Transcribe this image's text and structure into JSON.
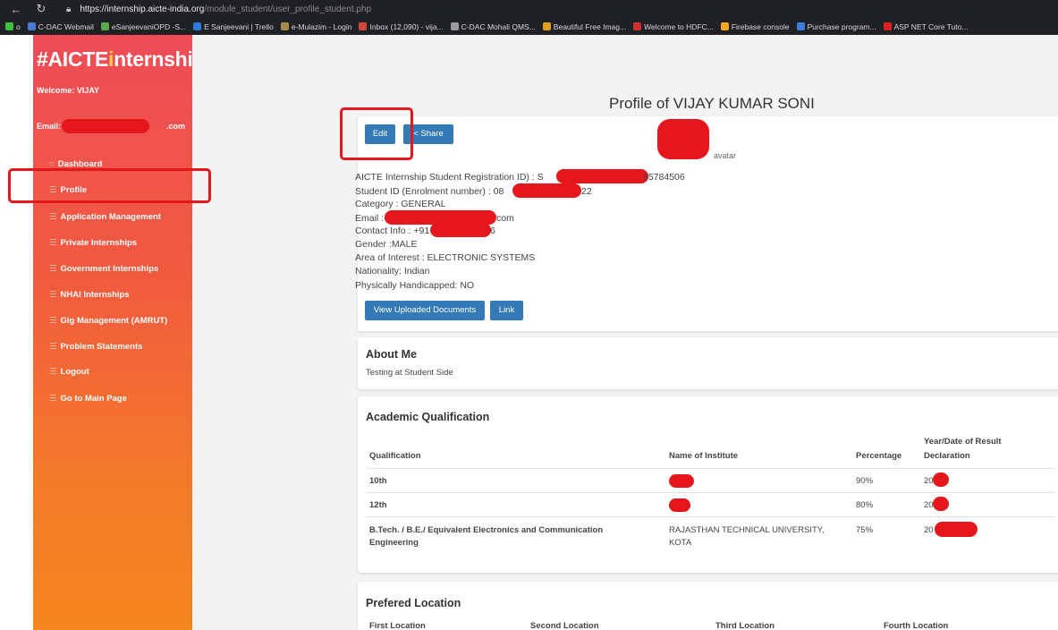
{
  "browser": {
    "url_host": "https://internship.aicte-india.org",
    "url_path": "/module_student/user_profile_student.php",
    "bookmarks": [
      {
        "label": "o",
        "color": "#3fbf3f"
      },
      {
        "label": "C-DAC Webmail",
        "color": "#4a7bd4"
      },
      {
        "label": "eSanjeevaniOPD -S...",
        "color": "#5aa64a"
      },
      {
        "label": "E Sanjeevani | Trello",
        "color": "#2c7bd6"
      },
      {
        "label": "e-Mulazim - Login",
        "color": "#a58a4f"
      },
      {
        "label": "Inbox (12,090) - vija...",
        "color": "#d4463c"
      },
      {
        "label": "C-DAC Mohali QMS...",
        "color": "#9a9a9a"
      },
      {
        "label": "Beautiful Free Imag...",
        "color": "#e0a020"
      },
      {
        "label": "Welcome to HDFC...",
        "color": "#d03030"
      },
      {
        "label": "Firebase console",
        "color": "#f5a623"
      },
      {
        "label": "Purchase program...",
        "color": "#3b7dd8"
      },
      {
        "label": "ASP NET Core Tuto...",
        "color": "#e02020"
      }
    ]
  },
  "sidebar": {
    "brand_prefix": "#AICTE",
    "brand_i": "i",
    "brand_suffix": "nternship",
    "welcome": "Welcome: VIJAY",
    "email_prefix": "Email: vija",
    "email_suffix": ".com",
    "dashboard_icon": "○",
    "menu_icon": "☰",
    "items": [
      "Dashboard",
      "Profile",
      "Application Management",
      "Private Internships",
      "Government Internships",
      "NHAI Internships",
      "Gig Management (AMRUT)",
      "Problem Statements",
      "Logout",
      "Go to Main Page"
    ]
  },
  "header": {
    "hamburger": "≡"
  },
  "profile": {
    "title": "Profile of VIJAY KUMAR SONI",
    "edit_label": "Edit",
    "share_label": "Share",
    "share_icon": "<",
    "avatar_alt": "avatar",
    "fields": [
      {
        "prefix": "AICTE Internship Student Registration ID) : S",
        "suffix": "65784506"
      },
      {
        "prefix": "Student ID (Enrolment number) : 08",
        "suffix": "22"
      },
      {
        "prefix": "Category : GENERAL",
        "suffix": ""
      },
      {
        "prefix": "Email : vij",
        "suffix": "com"
      },
      {
        "prefix": "Contact Info : +91",
        "suffix": "6"
      },
      {
        "prefix": "Gender :MALE",
        "suffix": ""
      },
      {
        "prefix": "Area of Interest : ELECTRONIC SYSTEMS",
        "suffix": ""
      },
      {
        "prefix": "Nationality: Indian",
        "suffix": ""
      },
      {
        "prefix": "Physically Handicapped: NO",
        "suffix": ""
      }
    ],
    "view_docs_label": "View Uploaded Documents",
    "link_label": "Link"
  },
  "about": {
    "heading": "About Me",
    "text": "Testing at Student Side"
  },
  "academic": {
    "heading": "Academic Qualification",
    "columns": [
      "Qualification",
      "Name of Institute",
      "Percentage",
      "Year/Date of Result",
      "Declaration"
    ],
    "rows": [
      {
        "qualification": "10th",
        "institute": "",
        "percentage": "90%",
        "year": "20"
      },
      {
        "qualification": "12th",
        "institute": "",
        "percentage": "80%",
        "year": "20"
      },
      {
        "qualification_line1": "B.Tech. / B.E./ Equivalent Electronics and Communication",
        "qualification_line2": "Engineering",
        "institute_line1": "RAJASTHAN TECHNICAL UNIVERSITY,",
        "institute_line2": "KOTA",
        "percentage": "75%",
        "year": "20"
      }
    ]
  },
  "location": {
    "heading": "Prefered Location",
    "columns": [
      "First Location",
      "Second Location",
      "Third Location",
      "Fourth Location"
    ]
  },
  "colors": {
    "accent": "#337ab7",
    "annotation": "#e5171d",
    "sidebar_top": "#ee4c57",
    "sidebar_bottom": "#f6861f"
  }
}
